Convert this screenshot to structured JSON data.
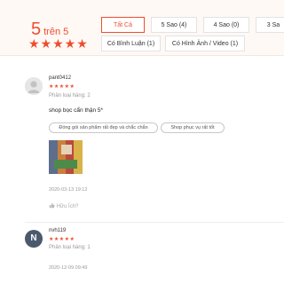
{
  "summary": {
    "score": "5",
    "score_suffix": "trên 5",
    "stars": "★★★★★",
    "filters": {
      "all": "Tất Cả",
      "five": "5 Sao (4)",
      "four": "4 Sao (0)",
      "three": "3 Sa",
      "with_comment": "Có Bình Luận (1)",
      "with_media": "Có Hình Ảnh / Video (1)"
    }
  },
  "reviews": [
    {
      "username": "pant0412",
      "stars": "★★★★★",
      "variant": "Phân loại hàng: 2",
      "comment": "shop bọc cẩn thận 5*",
      "tags": [
        "Đóng gói sản phẩm rất đẹp và chắc chắn",
        "Shop phục vụ rất tốt"
      ],
      "time": "2020-03-13 19:12",
      "helpful": "Hữu Ích?"
    },
    {
      "avatar_letter": "N",
      "username": "nvh119",
      "stars": "★★★★★",
      "variant": "Phân loại hàng: 1",
      "time": "2020-12-09 09:49"
    }
  ],
  "icons": {
    "like": "thumbs-up-icon",
    "rating": "star-icon"
  },
  "colors": {
    "accent": "#ee4d2d",
    "summary_bg": "#fff9f6",
    "avatar_n": "#4a5a6c"
  }
}
